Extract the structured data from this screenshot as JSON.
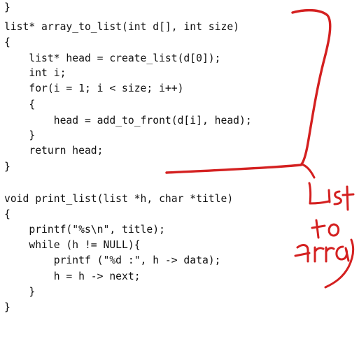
{
  "code": {
    "lines": [
      "}",
      "list* array_to_list(int d[], int size)",
      "{",
      "    list* head = create_list(d[0]);",
      "    int i;",
      "    for(i = 1; i < size; i++)",
      "    {",
      "        head = add_to_front(d[i], head);",
      "    }",
      "    return head;",
      "}",
      "",
      "void print_list(list *h, char *title)",
      "{",
      "    printf(\"%s\\n\", title);",
      "    while (h != NULL){",
      "        printf (\"%d :\", h -> data);",
      "        h = h -> next;",
      "    }",
      "}"
    ]
  },
  "annotation": {
    "handwriting": "List to Array",
    "ink_color": "#d42020"
  }
}
